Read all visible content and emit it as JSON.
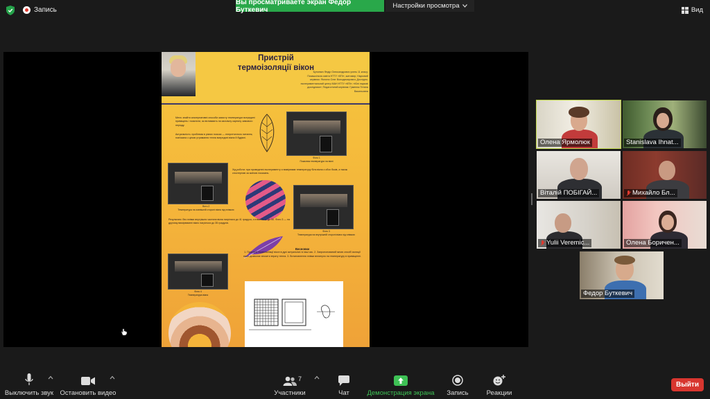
{
  "topbar": {
    "record_label": "Запись",
    "share_banner": "Вы просматриваете экран Федор Буткевич",
    "view_options": "Настройки просмотра",
    "view_label": "Вид"
  },
  "poster": {
    "title_line1": "Пристрій",
    "title_line2": "термоізоляції вікон",
    "authors": "Буткевич Федір Олександрович учень 11 класу; Позашкільна освіта НТТУ «КПІ», житомир; Науковий керівник: Ясюхно Олег Володимирович; Дослідно-експериментальний центр МАН НТТУ «КПІ»; «Юні наукові дослідники»; Педагогічний керівник: Гуменюк Тетяна Васильовна",
    "goal": "Мета: знайти альтернативні способи захисту температури всередині приміщень і пояснити, як впливають на загальну картину зимового періоду.",
    "relevance": "Актуальність: проблема в різних поясах — енергетичного питання, пов'язана з ціною утримання тепла всередині вікна й будівлі.",
    "work": "Хід роботи: при проведенні експерименту я вимірював температуру біля вікна з обох боків, а також спостерігав за зміною показань.",
    "results": "Результати: без плівки внутрішня частина вікна нагрілася до 41 градуса, з плівкою — до 50. Фото 3 — на другому вимірюванні вікно нагрілося до 35 градусів.",
    "conclusions_title": "Висновки",
    "conclusions": "1. Пристрій термоізоляції вікон в дусі актуальних в наш час. 2. Запропонований мною спосіб ізоляції вікон дозволяє знизити втрату тепла. 3. Встановлення плівки вплинуло на температуру в приміщенні.",
    "photo1_caption": "Фото 1",
    "photo2_caption": "Фото 2",
    "photo3_caption": "Фото 3",
    "photo4_caption": "Фото 4",
    "photo1_desc": "Показник температури на вікні",
    "photo2_desc": "Температура на зовнішній стороні вікна під плівкою",
    "photo3_desc": "Температура на внутрішній стороні вікна під плівкою",
    "photo4_desc": "Температура вікна"
  },
  "participants": [
    {
      "name": "Олена Ярмолюк",
      "muted": false
    },
    {
      "name": "Stanislava Ihnat...",
      "muted": false
    },
    {
      "name": "Віталій ПОБІГАЙ...",
      "muted": false
    },
    {
      "name": "Михайло Бл...",
      "muted": true
    },
    {
      "name": "Yulii Veremic...",
      "muted": true
    },
    {
      "name": "Олена Боричен...",
      "muted": false
    },
    {
      "name": "Федор Буткевич",
      "muted": false
    }
  ],
  "toolbar": {
    "mute": "Выключить звук",
    "video": "Остановить видео",
    "participants": "Участники",
    "participants_count": "7",
    "chat": "Чат",
    "share": "Демонстрация экрана",
    "record": "Запись",
    "reactions": "Реакции",
    "leave": "Выйти"
  },
  "colors": {
    "share_green": "#29a84a",
    "leave_red": "#d8362f",
    "active_speaker": "#c0d84a",
    "poster_yellow": "#f6c63e"
  }
}
